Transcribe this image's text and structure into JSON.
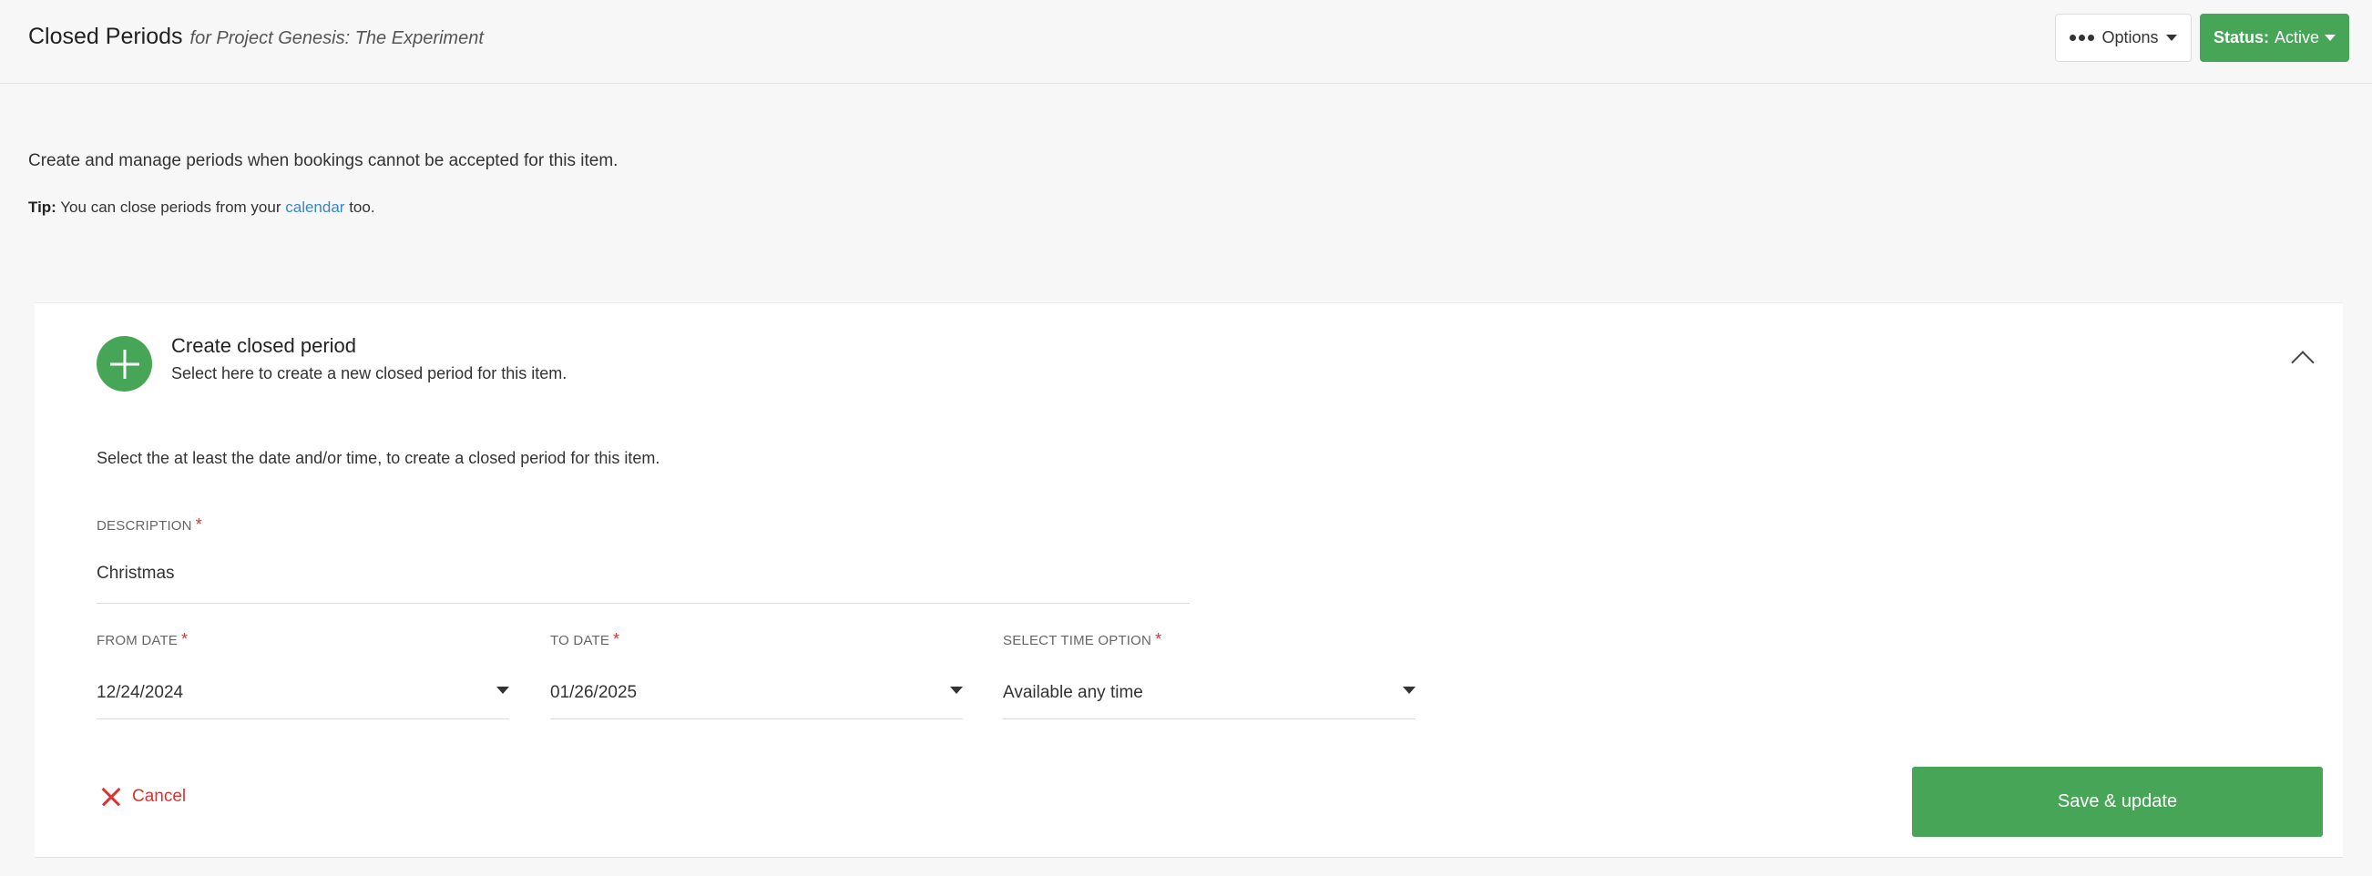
{
  "header": {
    "title": "Closed Periods",
    "subtitle": "for Project Genesis: The Experiment",
    "options_label": "Options",
    "status_label": "Status:",
    "status_value": "Active"
  },
  "intro": {
    "description": "Create and manage periods when bookings cannot be accepted for this item.",
    "tip_label": "Tip:",
    "tip_text_before": "You can close periods from your",
    "tip_link": "calendar",
    "tip_text_after": "too."
  },
  "card": {
    "title": "Create closed period",
    "subtitle": "Select here to create a new closed period for this item.",
    "instruction": "Select the at least the date and/or time, to create a closed period for this item.",
    "description_field": {
      "label": "DESCRIPTION",
      "value": "Christmas"
    },
    "from_date": {
      "label": "FROM DATE",
      "value": "12/24/2024"
    },
    "to_date": {
      "label": "TO DATE",
      "value": "01/26/2025"
    },
    "time_option": {
      "label": "SELECT TIME OPTION",
      "value": "Available any time"
    },
    "required_marker": "*",
    "cancel_label": "Cancel",
    "save_label": "Save & update"
  },
  "colors": {
    "accent_green": "#47a557",
    "link_blue": "#3a86c8",
    "danger_red": "#e03131"
  }
}
